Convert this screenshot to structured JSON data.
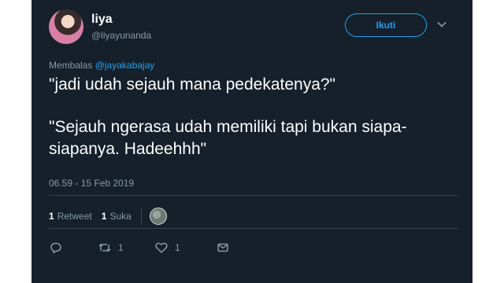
{
  "user": {
    "display_name": "liya",
    "handle": "@liyayunanda"
  },
  "follow_label": "Ikuti",
  "reply_to": {
    "prefix": "Membalas",
    "mention": "@jayakabajay"
  },
  "tweet": {
    "line1": "\"jadi udah sejauh mana pedekatenya?\"",
    "line2": "\"Sejauh ngerasa udah memiliki tapi bukan siapa-siapanya. Hadeehhh\""
  },
  "timestamp": "06.59 - 15 Feb 2019",
  "stats": {
    "retweets_count": "1",
    "retweets_label": "Retweet",
    "likes_count": "1",
    "likes_label": "Suka"
  },
  "actions": {
    "reply_icon": "speech-bubble",
    "retweet_icon": "retweet-arrows",
    "retweet_count": "1",
    "like_icon": "heart",
    "like_count": "1",
    "dm_icon": "envelope"
  },
  "colors": {
    "background": "#15202b",
    "accent": "#1da1f2",
    "muted_text": "#8899a6",
    "divider": "#38444d"
  }
}
